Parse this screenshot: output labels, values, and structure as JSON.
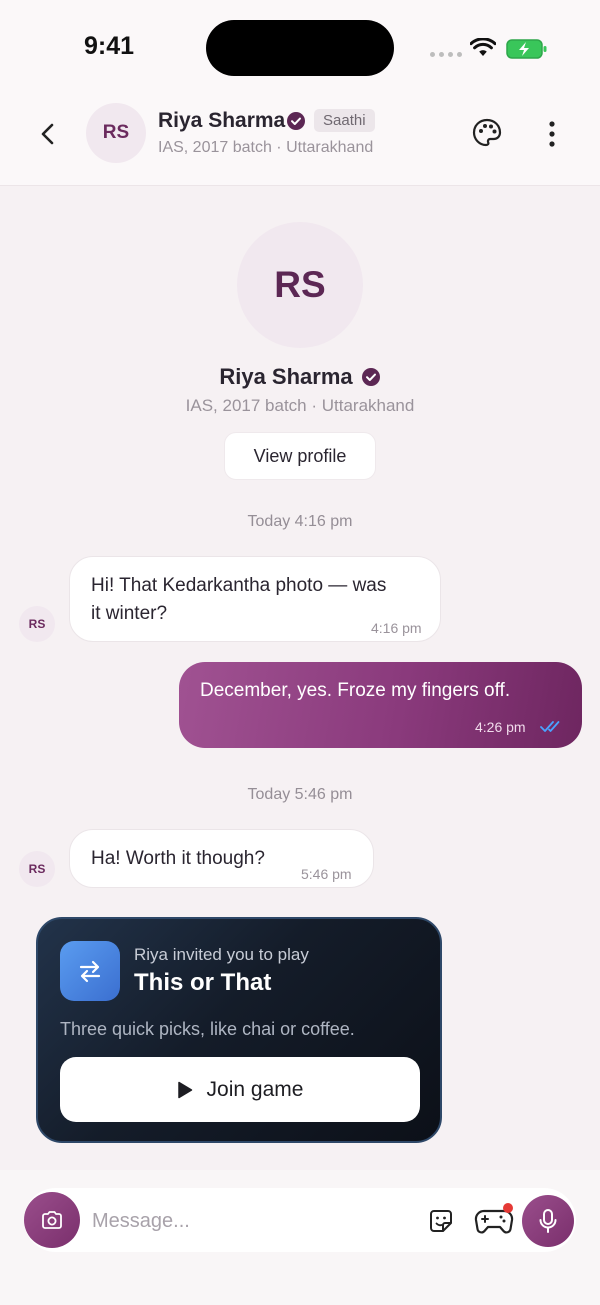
{
  "status_bar": {
    "time": "9:41"
  },
  "header": {
    "avatar_initials": "RS",
    "name": "Riya Sharma",
    "badge": "Saathi",
    "subtitle": "IAS, 2017 batch · Uttarakhand"
  },
  "profile": {
    "initials": "RS",
    "name": "Riya Sharma",
    "subtitle": "IAS, 2017 batch · Uttarakhand",
    "view_profile_label": "View profile"
  },
  "messages": {
    "day1": "Today 4:16 pm",
    "day2": "Today 5:46 pm",
    "m1": {
      "initials": "RS",
      "text_line1": "Hi! That Kedarkantha photo — was",
      "text_line2": "it winter?",
      "time": "4:16 pm"
    },
    "m2": {
      "text": "December, yes. Froze my fingers off.",
      "time": "4:26 pm",
      "status": "read"
    },
    "m3": {
      "initials": "RS",
      "text": "Ha! Worth it though?",
      "time": "5:46 pm"
    }
  },
  "game_invite": {
    "invite_text": "Riya invited you to play",
    "title": "This or That",
    "description": "Three quick picks, like chai or coffee.",
    "join_label": "Join game"
  },
  "composer": {
    "placeholder": "Message..."
  },
  "colors": {
    "brand": "#7a2f6c",
    "read_ticks": "#4aa3ff",
    "notification_dot": "#e53935"
  }
}
